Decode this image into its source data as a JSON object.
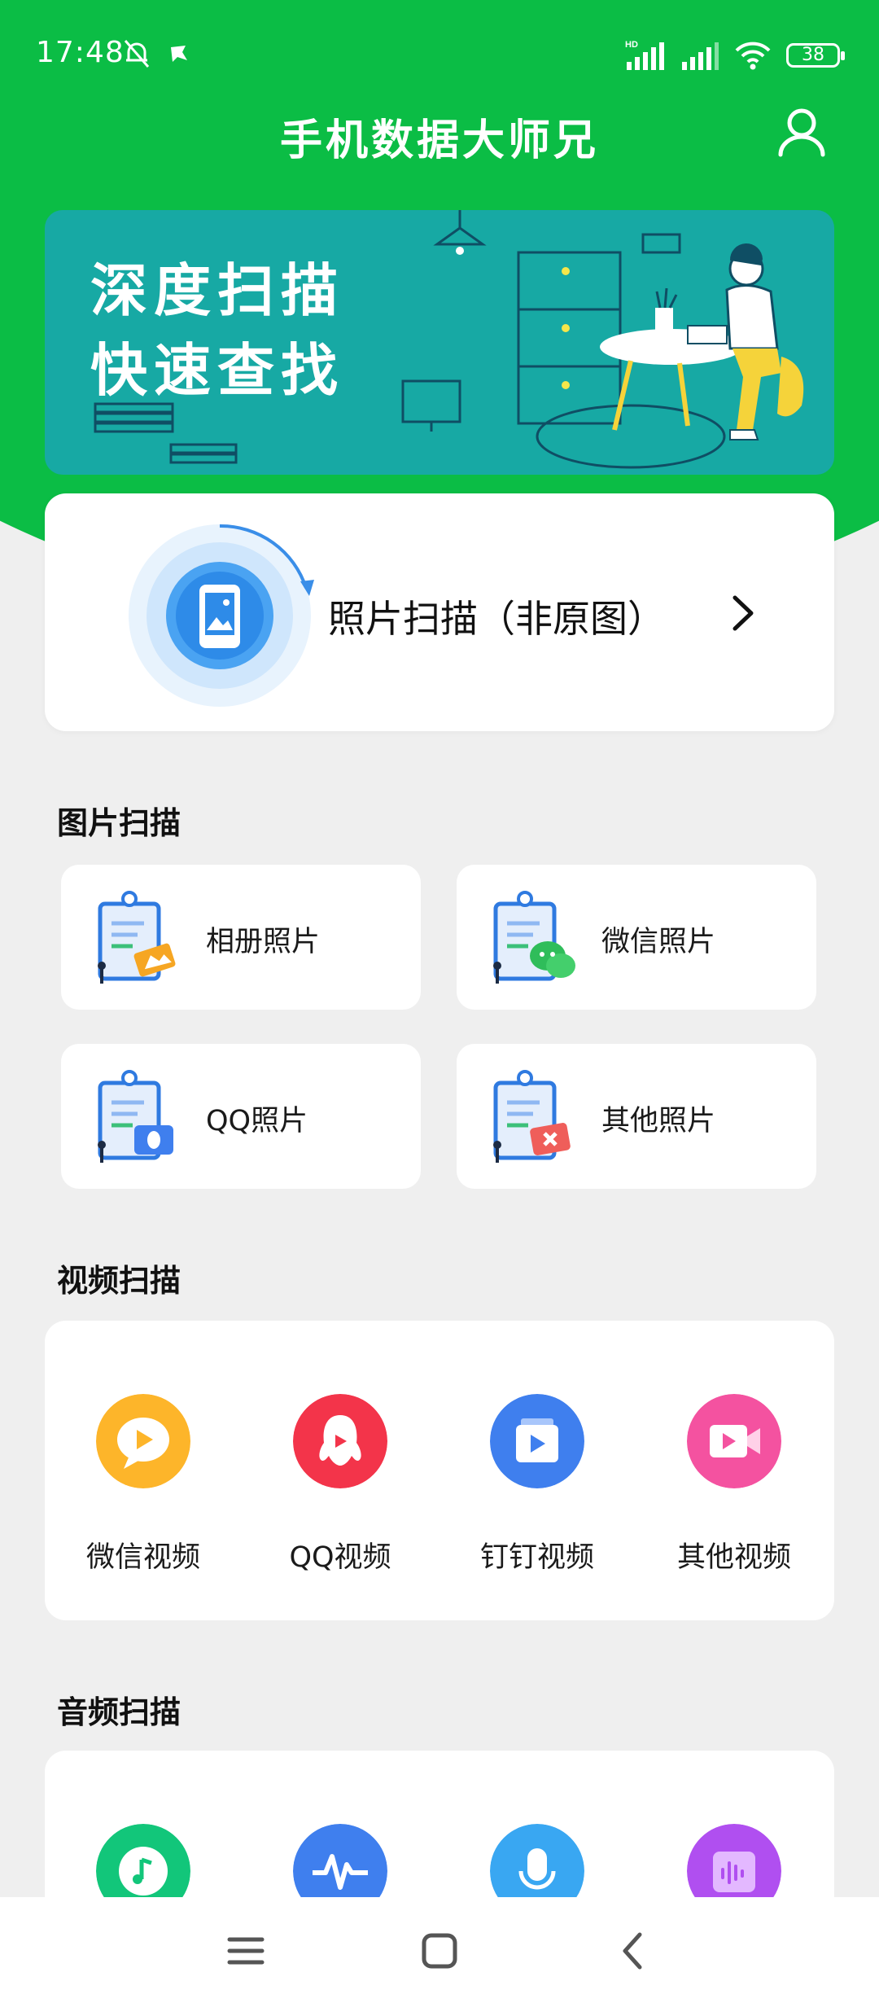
{
  "status_bar": {
    "time": "17:48",
    "network_badge": "HD",
    "battery": "38"
  },
  "header": {
    "title": "手机数据大师兄"
  },
  "banner": {
    "line1": "深度扫描",
    "line2": "快速查找"
  },
  "photo_scan": {
    "label": "照片扫描（非原图）"
  },
  "image_section": {
    "title": "图片扫描",
    "items": [
      {
        "label": "相册照片",
        "icon": "album-photo-icon"
      },
      {
        "label": "微信照片",
        "icon": "wechat-photo-icon"
      },
      {
        "label": "QQ照片",
        "icon": "qq-photo-icon"
      },
      {
        "label": "其他照片",
        "icon": "other-photo-icon"
      }
    ]
  },
  "video_section": {
    "title": "视频扫描",
    "items": [
      {
        "label": "微信视频",
        "icon": "wechat-video-icon"
      },
      {
        "label": "QQ视频",
        "icon": "qq-video-icon"
      },
      {
        "label": "钉钉视频",
        "icon": "dingtalk-video-icon"
      },
      {
        "label": "其他视频",
        "icon": "other-video-icon"
      }
    ]
  },
  "audio_section": {
    "title": "音频扫描",
    "items": [
      {
        "icon": "music-audio-icon"
      },
      {
        "icon": "waveform-audio-icon"
      },
      {
        "icon": "microphone-audio-icon"
      },
      {
        "icon": "voice-audio-icon"
      }
    ]
  },
  "colors": {
    "brand_green": "#0bbd45",
    "banner_teal": "#17a9a4",
    "yellow": "#fdb52a",
    "red": "#f3344a",
    "blue": "#3f7fee",
    "pink": "#f452a0",
    "green": "#12c67a",
    "purple": "#b04ff0"
  }
}
